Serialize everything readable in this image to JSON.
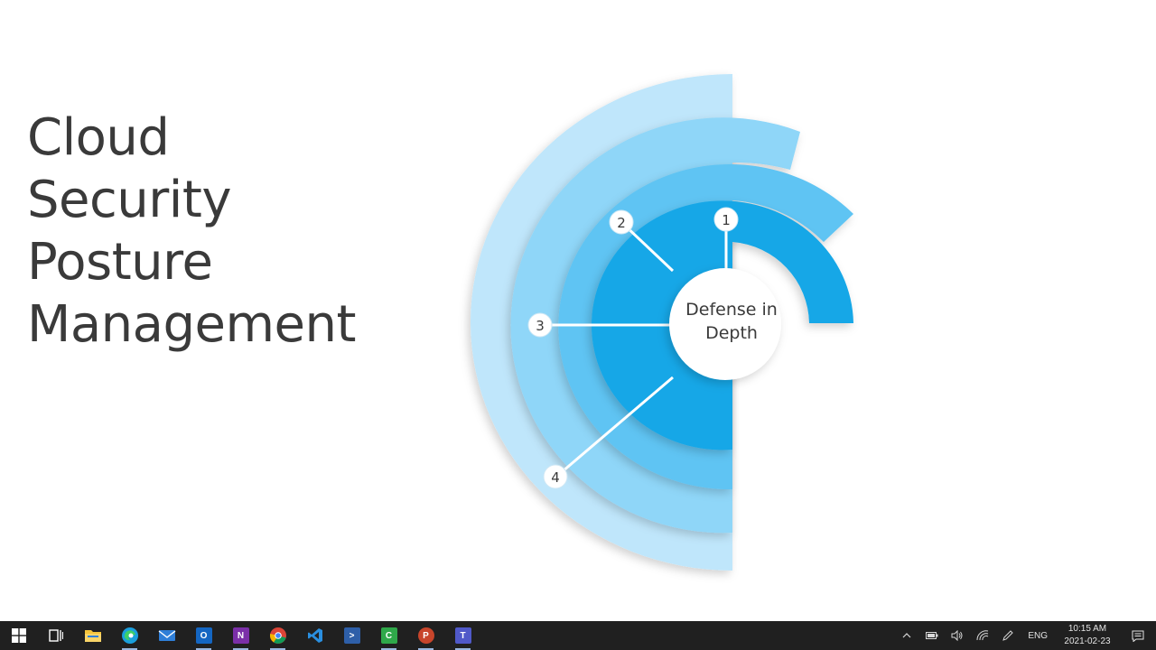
{
  "slide": {
    "title_lines": [
      "Cloud",
      "Security",
      "Posture",
      "Management"
    ],
    "center_lines": [
      "Defense in",
      "Depth"
    ],
    "markers": [
      "1",
      "2",
      "3",
      "4"
    ]
  },
  "colors": {
    "ring_outer": "#bfe6fb",
    "ring_2": "#8fd6f8",
    "ring_3": "#5fc4f3",
    "ring_inner": "#14a7e7",
    "title_text": "#3a3a3a",
    "taskbar": "#202020"
  },
  "taskbar": {
    "apps": [
      {
        "name": "start-icon",
        "letter": "",
        "color": "#ffffff"
      },
      {
        "name": "task-view-icon",
        "letter": "",
        "color": "#ffffff"
      },
      {
        "name": "file-explorer-icon",
        "letter": "",
        "color": "#f5c43b"
      },
      {
        "name": "edge-icon",
        "letter": "",
        "color": "#1a9fde"
      },
      {
        "name": "mail-icon",
        "letter": "",
        "color": "#2f7fd8"
      },
      {
        "name": "outlook-icon",
        "letter": "O",
        "color": "#1466c2"
      },
      {
        "name": "onenote-icon",
        "letter": "N",
        "color": "#7b2fa8"
      },
      {
        "name": "chrome-icon",
        "letter": "",
        "color": "#db4437"
      },
      {
        "name": "vscode-icon",
        "letter": "",
        "color": "#2a8fe0"
      },
      {
        "name": "powershell-icon",
        "letter": ">",
        "color": "#2e5fa8"
      },
      {
        "name": "camtasia-icon",
        "letter": "C",
        "color": "#2fa84a"
      },
      {
        "name": "powerpoint-icon",
        "letter": "P",
        "color": "#c8452b"
      },
      {
        "name": "teams-icon",
        "letter": "T",
        "color": "#5059c9"
      }
    ],
    "tray": {
      "language": "ENG",
      "time": "10:15 AM",
      "date": "2021-02-23"
    }
  }
}
